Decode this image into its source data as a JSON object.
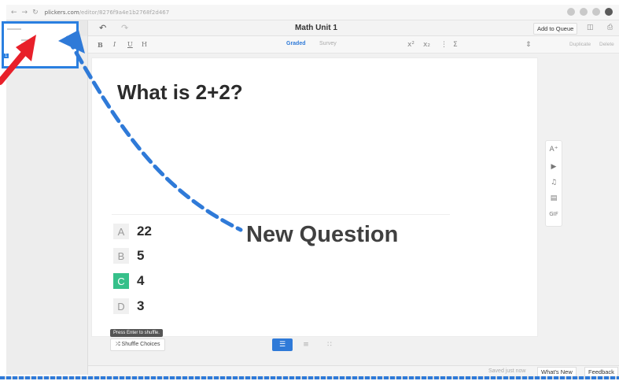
{
  "browser": {
    "url_host": "plickers.com",
    "url_path": "/editor/8276f9a4e1b2768f2d467"
  },
  "topbar": {
    "title": "Math Unit 1",
    "add_to_queue": "Add to Queue"
  },
  "formatbar": {
    "bold": "B",
    "italic": "I",
    "underline": "U",
    "highlight": "H",
    "mode_graded": "Graded",
    "mode_survey": "Survey",
    "duplicate": "Duplicate",
    "delete": "Delete"
  },
  "sidebar": {
    "slide_number": "1"
  },
  "question": {
    "text": "What is 2+2?",
    "choices": [
      {
        "letter": "A",
        "text": "22",
        "correct": false
      },
      {
        "letter": "B",
        "text": "5",
        "correct": false
      },
      {
        "letter": "C",
        "text": "4",
        "correct": true
      },
      {
        "letter": "D",
        "text": "3",
        "correct": false
      }
    ]
  },
  "media": {
    "gif": "GIF"
  },
  "tooltip": "Press Enter to shuffle.",
  "shuffle_button": "Shuffle Choices",
  "footer": {
    "saved": "Saved just now",
    "whats_new": "What's New",
    "feedback": "Feedback"
  },
  "annotation": {
    "label": "New Question",
    "arrow_color": "#e8202a",
    "dash_color": "#2f7ad8"
  },
  "colors": {
    "accent": "#2f7ad8",
    "correct": "#36c08a"
  }
}
